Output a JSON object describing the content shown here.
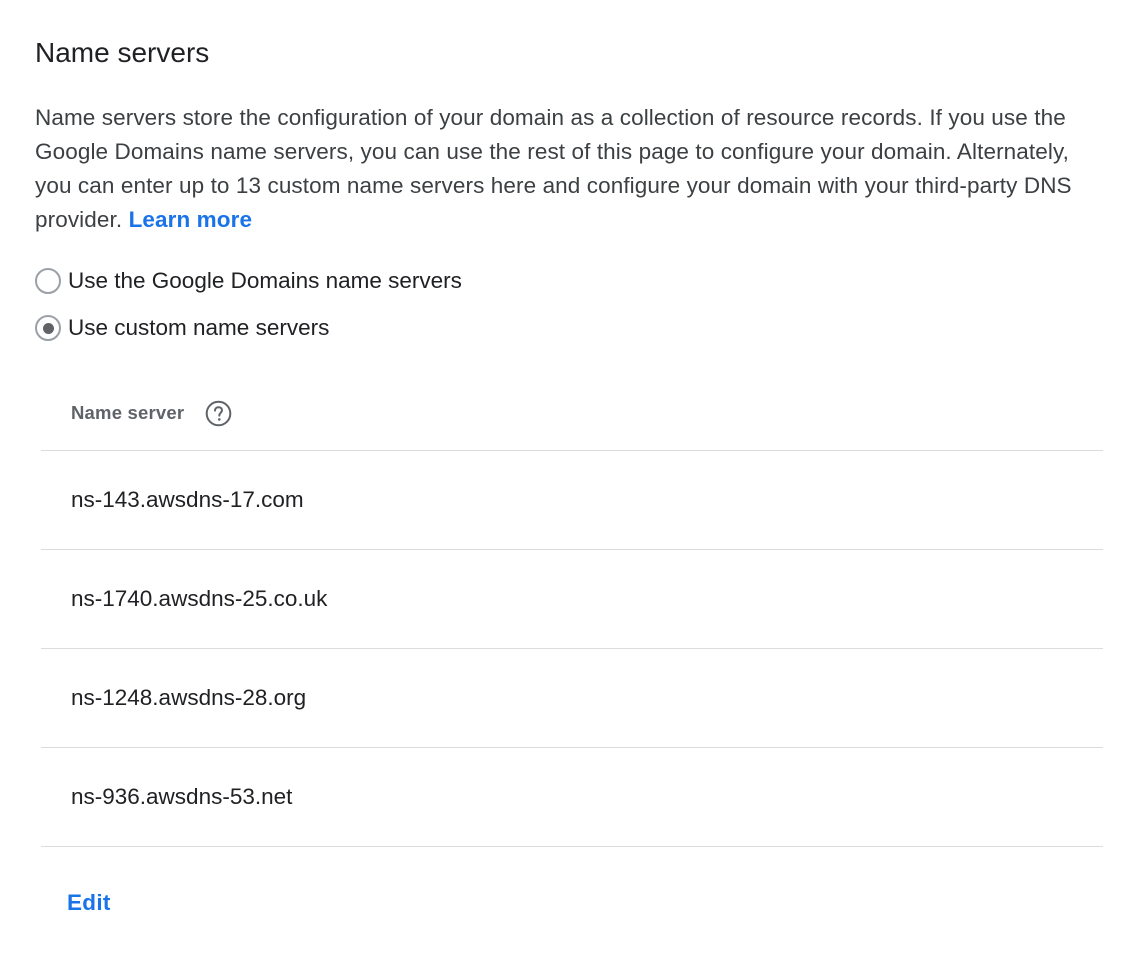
{
  "section": {
    "title": "Name servers",
    "description": "Name servers store the configuration of your domain as a collection of resource records. If you use the Google Domains name servers, you can use the rest of this page to configure your domain. Alternately, you can enter up to 13 custom name servers here and configure your domain with your third-party DNS provider.",
    "learn_more_label": "Learn more"
  },
  "options": [
    {
      "label": "Use the Google Domains name servers",
      "selected": false
    },
    {
      "label": "Use custom name servers",
      "selected": true
    }
  ],
  "table": {
    "column_header": "Name server",
    "help_icon": "help-circle-icon",
    "rows": [
      "ns-143.awsdns-17.com",
      "ns-1740.awsdns-25.co.uk",
      "ns-1248.awsdns-28.org",
      "ns-936.awsdns-53.net"
    ]
  },
  "actions": {
    "edit_label": "Edit"
  },
  "colors": {
    "accent": "#1a73e8",
    "text_primary": "#202124",
    "text_secondary": "#5f6368",
    "divider": "#dadce0"
  }
}
